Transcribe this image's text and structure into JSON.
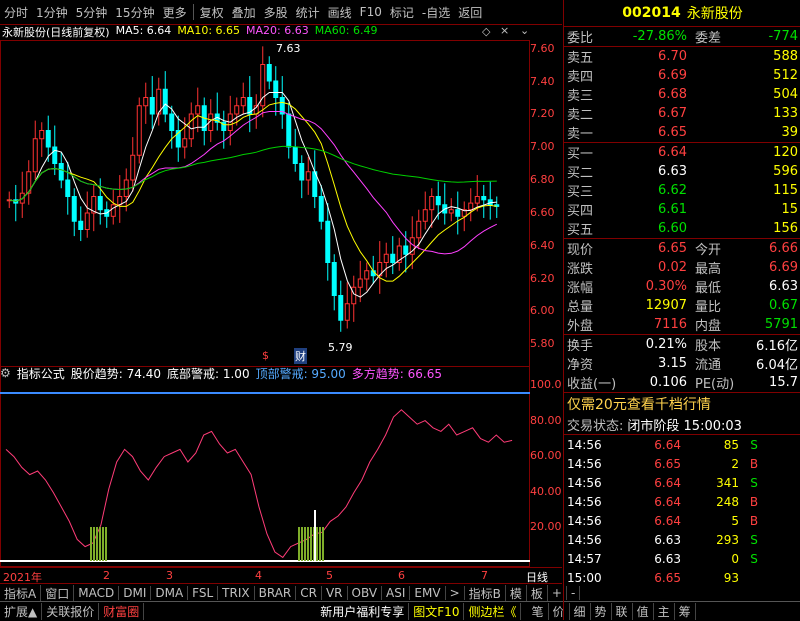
{
  "toolbar": {
    "items": [
      "分时",
      "1分钟",
      "5分钟",
      "15分钟",
      "更多",
      "复权",
      "叠加",
      "多股",
      "统计",
      "画线",
      "F10",
      "标记",
      "-自选",
      "返回"
    ]
  },
  "chart": {
    "title": "永新股份(日线前复权)",
    "ma5": "MA5: 6.64",
    "ma10": "MA10: 6.65",
    "ma20": "MA20: 6.63",
    "ma60": "MA60: 6.49",
    "high_label": "7.63",
    "low_label": "5.79",
    "price_axis": [
      "7.60",
      "7.40",
      "7.20",
      "7.00",
      "6.80",
      "6.60",
      "6.40",
      "6.20",
      "6.00",
      "5.80"
    ],
    "markers": [
      "$",
      "财"
    ]
  },
  "indicator": {
    "name": "指标公式",
    "trend": "股价趋势: 74.40",
    "bottom": "底部警戒: 1.00",
    "top": "顶部警戒: 95.00",
    "multi": "多方趋势: 66.65",
    "axis": [
      "100.0",
      "80.00",
      "60.00",
      "40.00",
      "20.00"
    ]
  },
  "time_axis": [
    "2021年",
    "2",
    "3",
    "4",
    "5",
    "6",
    "7"
  ],
  "time_axis_right": "日线",
  "bottom_tabs": [
    "指标A",
    "窗口",
    "MACD",
    "DMI",
    "DMA",
    "FSL",
    "TRIX",
    "BRAR",
    "CR",
    "VR",
    "OBV",
    "ASI",
    "EMV",
    ">",
    "指标B",
    "模",
    "板",
    "+",
    "-"
  ],
  "footer_left": [
    "扩展▲",
    "关联报价",
    "财富圈"
  ],
  "footer_mid": [
    "新用户福利专享",
    "图文F10",
    "侧边栏《"
  ],
  "footer_right": [
    "笔",
    "价",
    "细",
    "势",
    "联",
    "值",
    "主",
    "筹"
  ],
  "stock": {
    "code": "002014",
    "name": "永新股份",
    "weibi_label": "委比",
    "weibi": "-27.86%",
    "weicha_label": "委差",
    "weicha": "-774",
    "asks": [
      {
        "label": "卖五",
        "price": "6.70",
        "vol": "588"
      },
      {
        "label": "卖四",
        "price": "6.69",
        "vol": "512"
      },
      {
        "label": "卖三",
        "price": "6.68",
        "vol": "504"
      },
      {
        "label": "卖二",
        "price": "6.67",
        "vol": "133"
      },
      {
        "label": "卖一",
        "price": "6.65",
        "vol": "39"
      }
    ],
    "bids": [
      {
        "label": "买一",
        "price": "6.64",
        "vol": "120"
      },
      {
        "label": "买二",
        "price": "6.63",
        "vol": "596"
      },
      {
        "label": "买三",
        "price": "6.62",
        "vol": "115"
      },
      {
        "label": "买四",
        "price": "6.61",
        "vol": "15"
      },
      {
        "label": "买五",
        "price": "6.60",
        "vol": "156"
      }
    ],
    "quote": [
      {
        "l1": "现价",
        "v1": "6.65",
        "l2": "今开",
        "v2": "6.66"
      },
      {
        "l1": "涨跌",
        "v1": "0.02",
        "l2": "最高",
        "v2": "6.69"
      },
      {
        "l1": "涨幅",
        "v1": "0.30%",
        "l2": "最低",
        "v2": "6.63"
      },
      {
        "l1": "总量",
        "v1": "12907",
        "l2": "量比",
        "v2": "0.67"
      },
      {
        "l1": "外盘",
        "v1": "7116",
        "l2": "内盘",
        "v2": "5791"
      }
    ],
    "stats": [
      {
        "l1": "换手",
        "v1": "0.21%",
        "l2": "股本",
        "v2": "6.16亿"
      },
      {
        "l1": "净资",
        "v1": "3.15",
        "l2": "流通",
        "v2": "6.04亿"
      },
      {
        "l1": "收益(一)",
        "v1": "0.106",
        "l2": "PE(动)",
        "v2": "15.7"
      }
    ],
    "promo": "仅需20元查看千档行情",
    "status_label": "交易状态:",
    "status": "闭市阶段 15:00:03",
    "ticks": [
      {
        "t": "14:56",
        "p": "6.64",
        "v": "85",
        "s": "S"
      },
      {
        "t": "14:56",
        "p": "6.65",
        "v": "2",
        "s": "B"
      },
      {
        "t": "14:56",
        "p": "6.64",
        "v": "341",
        "s": "S"
      },
      {
        "t": "14:56",
        "p": "6.64",
        "v": "248",
        "s": "B"
      },
      {
        "t": "14:56",
        "p": "6.64",
        "v": "5",
        "s": "B"
      },
      {
        "t": "14:56",
        "p": "6.63",
        "v": "293",
        "s": "S"
      },
      {
        "t": "14:57",
        "p": "6.63",
        "v": "0",
        "s": "S"
      },
      {
        "t": "15:00",
        "p": "6.65",
        "v": "93",
        "s": ""
      }
    ]
  }
}
